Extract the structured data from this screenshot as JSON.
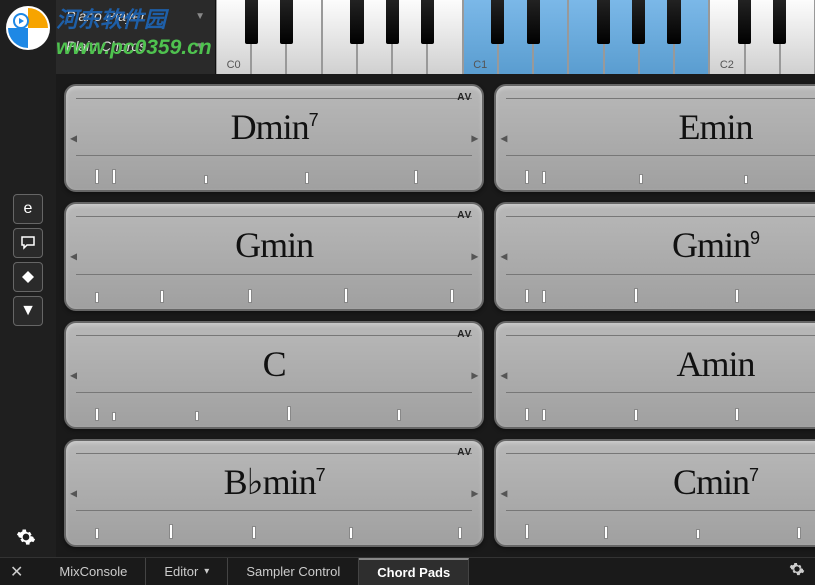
{
  "watermark": {
    "cn": "河东软件园",
    "url": "www.pc0359.cn"
  },
  "presets": {
    "player": "Piano Player",
    "chords": "Plain Chords"
  },
  "piano": {
    "labels": [
      "C0",
      "C1",
      "C2"
    ],
    "highlight_start": 7,
    "highlight_end": 14
  },
  "corner_label": "AV",
  "pads": [
    {
      "root": "D",
      "acc": "",
      "quality": "min",
      "ext": "7",
      "voicing": [
        4,
        6,
        40,
        44,
        48
      ]
    },
    {
      "root": "E",
      "acc": "",
      "quality": "min",
      "ext": "",
      "voicing": [
        4,
        6,
        42,
        46,
        50
      ]
    },
    {
      "root": "G",
      "acc": "",
      "quality": "min",
      "ext": "",
      "voicing": [
        4,
        28,
        38,
        42,
        46
      ]
    },
    {
      "root": "G",
      "acc": "",
      "quality": "min",
      "ext": "9",
      "voicing": [
        4,
        6,
        40,
        44,
        52
      ]
    },
    {
      "root": "C",
      "acc": "",
      "quality": "",
      "ext": "",
      "voicing": [
        4,
        6,
        36,
        40,
        48
      ]
    },
    {
      "root": "A",
      "acc": "",
      "quality": "min",
      "ext": "",
      "voicing": [
        4,
        6,
        40,
        44,
        48
      ]
    },
    {
      "root": "B",
      "acc": "♭",
      "quality": "min",
      "ext": "7",
      "voicing": [
        4,
        32,
        36,
        42,
        48
      ]
    },
    {
      "root": "C",
      "acc": "",
      "quality": "min",
      "ext": "7",
      "voicing": [
        4,
        34,
        40,
        44,
        50
      ]
    }
  ],
  "tabs": {
    "items": [
      "MixConsole",
      "Editor",
      "Sampler Control",
      "Chord Pads"
    ],
    "active": 3,
    "dropdown_on": 1
  },
  "colors": {
    "highlight": "#6cb0e0",
    "pad_bg": "#b0b0b0"
  }
}
